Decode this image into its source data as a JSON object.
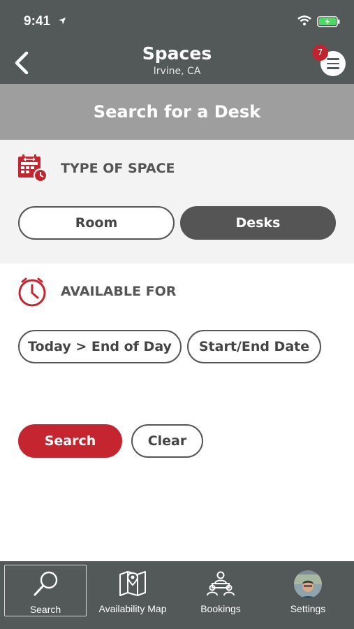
{
  "status": {
    "time": "9:41"
  },
  "header": {
    "title": "Spaces",
    "subtitle": "Irvine, CA",
    "badge_count": "7"
  },
  "banner": {
    "text": "Search for a Desk"
  },
  "type_of_space": {
    "label": "TYPE OF SPACE",
    "options": [
      {
        "label": "Room",
        "selected": false
      },
      {
        "label": "Desks",
        "selected": true
      }
    ]
  },
  "available_for": {
    "label": "AVAILABLE FOR",
    "options": [
      {
        "label": "Today > End of Day"
      },
      {
        "label": "Start/End Date"
      }
    ]
  },
  "actions": {
    "search_label": "Search",
    "clear_label": "Clear"
  },
  "tabbar": {
    "tabs": [
      {
        "label": "Search",
        "icon": "search-icon",
        "active": true
      },
      {
        "label": "Availability Map",
        "icon": "map-icon",
        "active": false
      },
      {
        "label": "Bookings",
        "icon": "bookings-icon",
        "active": false
      },
      {
        "label": "Settings",
        "icon": "avatar",
        "active": false
      }
    ]
  },
  "colors": {
    "header": "#535858",
    "banner": "#9e9e9e",
    "accent": "#c4252e",
    "pill_dark": "#555555"
  }
}
